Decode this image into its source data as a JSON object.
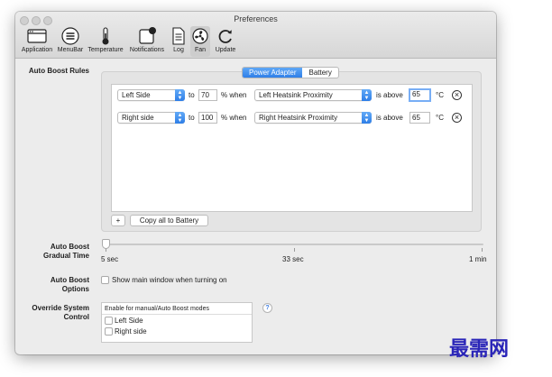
{
  "window": {
    "title": "Preferences"
  },
  "toolbar": [
    {
      "name": "application",
      "label": "Application"
    },
    {
      "name": "menubar",
      "label": "MenuBar"
    },
    {
      "name": "temperature",
      "label": "Temperature"
    },
    {
      "name": "notifications",
      "label": "Notifications"
    },
    {
      "name": "log",
      "label": "Log"
    },
    {
      "name": "fan",
      "label": "Fan",
      "selected": true
    },
    {
      "name": "update",
      "label": "Update"
    }
  ],
  "auto_boost_rules": {
    "label": "Auto Boost  Rules",
    "tabs": [
      {
        "label": "Power Adapter",
        "active": true
      },
      {
        "label": "Battery",
        "active": false
      }
    ],
    "rules": [
      {
        "fan": "Left Side",
        "to_label": "to",
        "percent": "70",
        "when_label": "% when",
        "sensor": "Left Heatsink Proximity",
        "is_above_label": "is above",
        "temp": "65",
        "unit": "°C"
      },
      {
        "fan": "Right side",
        "to_label": "to",
        "percent": "100",
        "when_label": "% when",
        "sensor": "Right Heatsink Proximity",
        "is_above_label": "is above",
        "temp": "65",
        "unit": "°C"
      }
    ],
    "add_label": "+",
    "copy_label": "Copy all to Battery"
  },
  "gradual_time": {
    "label_line1": "Auto Boost",
    "label_line2": "Gradual Time",
    "value_fraction": 0.0,
    "ticks": [
      "5 sec",
      "33 sec",
      "1 min"
    ]
  },
  "options": {
    "label_line1": "Auto Boost",
    "label_line2": "Options",
    "checkbox_label": "Show main window when turning on",
    "checked": false
  },
  "override": {
    "label_line1": "Override System",
    "label_line2": "Control",
    "header": "Enable for manual/Auto Boost modes",
    "items": [
      {
        "label": "Left Side",
        "checked": false
      },
      {
        "label": "Right side",
        "checked": false
      }
    ],
    "help": "?"
  },
  "watermark": "最需网",
  "colors": {
    "accent": "#2f7fe8",
    "window_bg": "#ececec"
  }
}
